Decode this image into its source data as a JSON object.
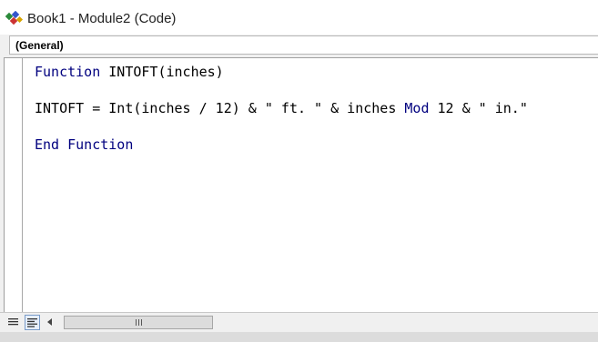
{
  "window": {
    "title": "Book1 - Module2 (Code)",
    "icon": "vba-module-icon"
  },
  "object_combo": {
    "selected": "(General)"
  },
  "code_lines": [
    [
      {
        "text": "Function",
        "kind": "keyword"
      },
      {
        "text": " INTOFT(inches)",
        "kind": "plain"
      }
    ],
    [],
    [
      {
        "text": "INTOFT = Int(inches / 12) & \" ft. \" & inches ",
        "kind": "plain"
      },
      {
        "text": "Mod",
        "kind": "keyword"
      },
      {
        "text": " 12 & \" in.\"",
        "kind": "plain"
      }
    ],
    [],
    [
      {
        "text": "End Function",
        "kind": "keyword"
      }
    ]
  ],
  "footer": {
    "procedure_view_icon": "procedure-view-icon",
    "full_module_view_icon": "full-module-view-icon",
    "scroll_grip": "III"
  },
  "colors": {
    "keyword": "#00007f",
    "text": "#000000",
    "background": "#ffffff"
  }
}
